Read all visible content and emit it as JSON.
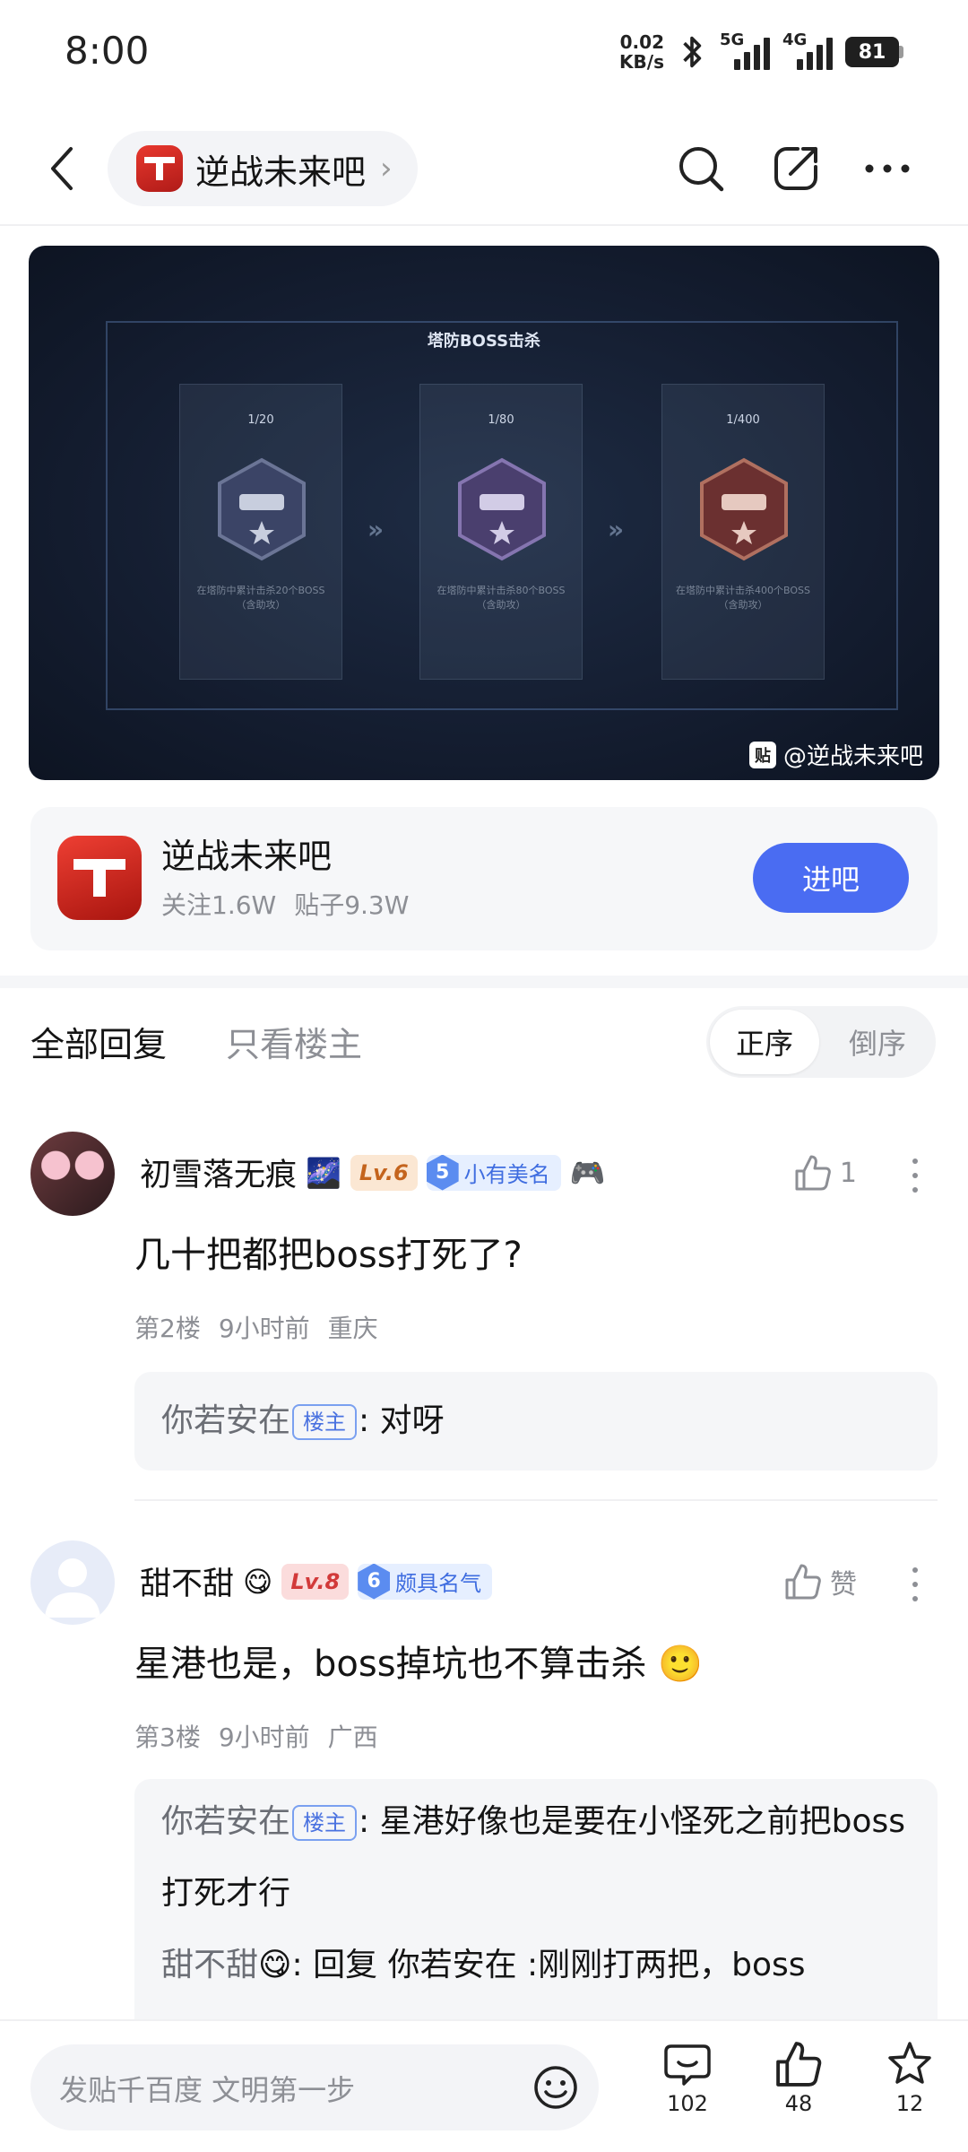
{
  "status": {
    "time": "8:00",
    "net_speed_value": "0.02",
    "net_speed_unit": "KB/s",
    "sim1": "5G",
    "sim2": "4G",
    "battery": "81"
  },
  "nav": {
    "forum_name": "逆战未来吧"
  },
  "banner": {
    "title": "塔防BOSS击杀",
    "cards": [
      {
        "count": "1/20",
        "desc": "在塔防中累计击杀20个BOSS（含助攻）"
      },
      {
        "count": "1/80",
        "desc": "在塔防中累计击杀80个BOSS（含助攻）"
      },
      {
        "count": "1/400",
        "desc": "在塔防中累计击杀400个BOSS（含助攻）"
      }
    ],
    "watermark": "@逆战未来吧"
  },
  "forum_card": {
    "name": "逆战未来吧",
    "followers": "关注1.6W",
    "posts": "贴子9.3W",
    "join_label": "进吧"
  },
  "tabs": {
    "all": "全部回复",
    "owner_only": "只看楼主",
    "sort_asc": "正序",
    "sort_desc": "倒序"
  },
  "posts": [
    {
      "username": "初雪落无痕",
      "level": "Lv.6",
      "badge_num": "5",
      "badge_text": "小有美名",
      "likes": "1",
      "content": "几十把都把boss打死了?",
      "floor": "第2楼",
      "time": "9小时前",
      "location": "重庆",
      "replies": [
        {
          "name": "你若安在",
          "tag": "楼主",
          "text": ": 对呀"
        }
      ]
    },
    {
      "username": "甜不甜",
      "level": "Lv.8",
      "badge_num": "6",
      "badge_text": "颇具名气",
      "likes": "赞",
      "content": "星港也是，boss掉坑也不算击杀",
      "floor": "第3楼",
      "time": "9小时前",
      "location": "广西",
      "replies": [
        {
          "name": "你若安在",
          "tag": "楼主",
          "text": ": 星港好像也是要在小怪死之前把boss打死才行"
        },
        {
          "name": "甜不甜",
          "tag": "",
          "text": ": 回复 你若安在 :刚刚打两把，boss"
        }
      ]
    }
  ],
  "bottom": {
    "placeholder": "发贴千百度 文明第一步",
    "comments": "102",
    "likes": "48",
    "favorites": "12"
  },
  "colors": {
    "accent": "#4a6cf2",
    "brand_red": "#d8271f"
  }
}
